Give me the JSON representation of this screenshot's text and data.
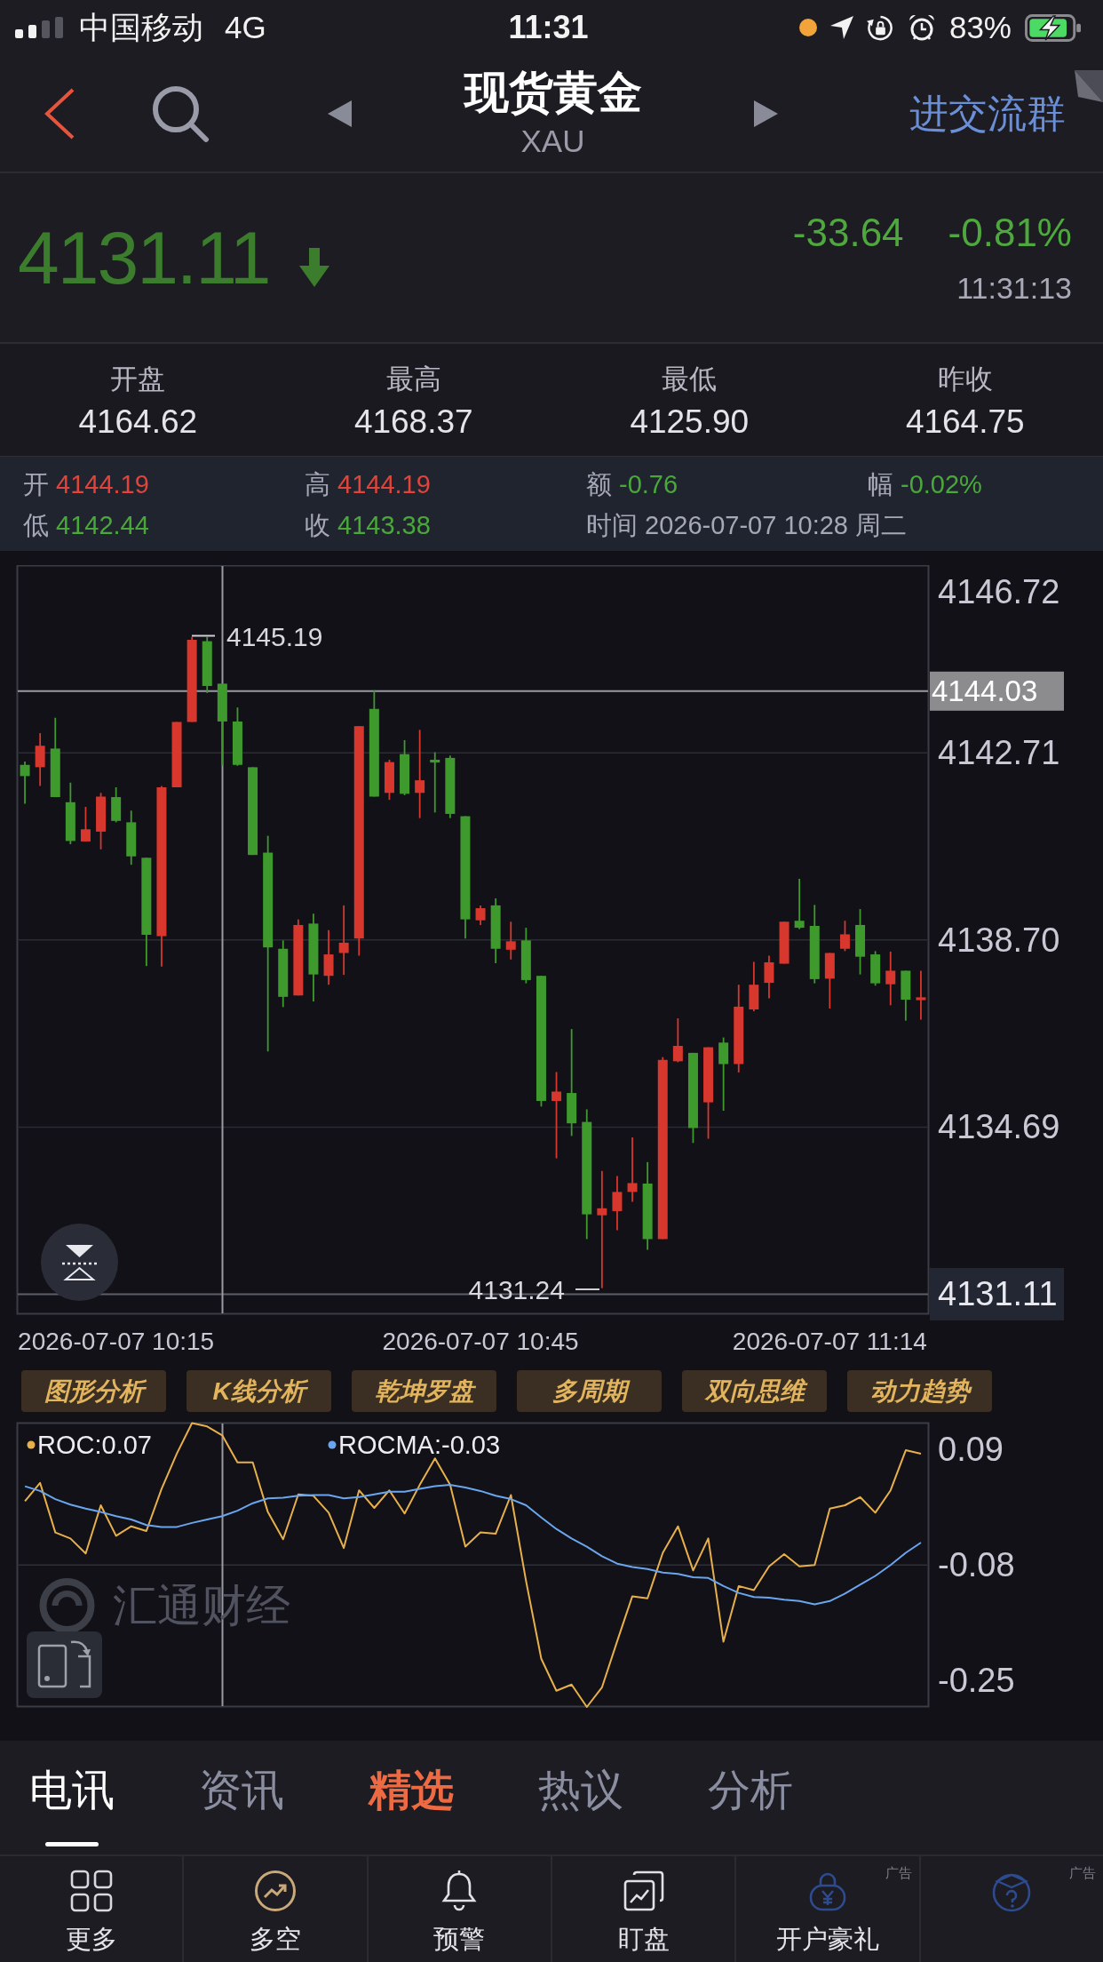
{
  "status_bar": {
    "carrier": "中国移动",
    "network": "4G",
    "time": "11:31",
    "battery": "83%"
  },
  "header": {
    "title": "现货黄金",
    "symbol": "XAU",
    "group_link": "进交流群"
  },
  "price": {
    "last": "4131.11",
    "rising": false,
    "change": "-33.64",
    "change_pct": "-0.81%",
    "time": "11:31:13"
  },
  "stats": [
    {
      "label": "开盘",
      "value": "4164.62"
    },
    {
      "label": "最高",
      "value": "4168.37"
    },
    {
      "label": "最低",
      "value": "4125.90"
    },
    {
      "label": "昨收",
      "value": "4164.75"
    }
  ],
  "quote_detail": [
    [
      {
        "label": "开",
        "value": "4144.19",
        "color": "#e0443a"
      },
      {
        "label": "高",
        "value": "4144.19",
        "color": "#e0443a"
      },
      {
        "label": "额",
        "value": "-0.76",
        "color": "#4aa83a"
      },
      {
        "label": "幅",
        "value": "-0.02%",
        "color": "#4aa83a"
      }
    ],
    [
      {
        "label": "低",
        "value": "4142.44",
        "color": "#4aa83a"
      },
      {
        "label": "收",
        "value": "4143.38",
        "color": "#4aa83a"
      },
      {
        "label": "时间",
        "value": "2026-07-07 10:28 周二",
        "color": "#a6a8b8"
      }
    ]
  ],
  "kline_chart": {
    "top_price_label": "4146.72",
    "high_label": "4145.19",
    "low_label": "4131.24",
    "chart_data": {
      "type": "candlestick",
      "categories": [
        null,
        null,
        null,
        null,
        null,
        null,
        "2026-07-07 10:15",
        null,
        null,
        null,
        null,
        null,
        null,
        null,
        null,
        null,
        null,
        null,
        null,
        null,
        null,
        null,
        null,
        null,
        null,
        null,
        null,
        null,
        null,
        null,
        "2026-07-07 10:45",
        null,
        null,
        null,
        null,
        null,
        null,
        null,
        null,
        null,
        null,
        null,
        null,
        null,
        null,
        null,
        null,
        null,
        null,
        null,
        null,
        null,
        null,
        "2026-07-07 11:14",
        null,
        null,
        null,
        null,
        null,
        null
      ],
      "ylim": [
        4130.69,
        4146.72
      ],
      "yticks": [
        {
          "value": 4142.71,
          "label": "4142.71"
        },
        {
          "value": 4138.7,
          "label": "4138.70"
        },
        {
          "value": 4134.69,
          "label": "4134.69"
        }
      ],
      "grid": true,
      "ref_lines": [
        {
          "axis": "y",
          "value": 4144.03,
          "label": "4144.03",
          "color": "#9a9aa2"
        },
        {
          "axis": "y",
          "value": 4131.11,
          "label": "4131.11",
          "color": "#5c5e68"
        }
      ],
      "ohlc": [
        [
          4142.45,
          4142.52,
          4141.62,
          4142.21
        ],
        [
          4142.4,
          4143.13,
          4142.0,
          4142.86
        ],
        [
          4142.8,
          4143.46,
          4141.76,
          4141.76
        ],
        [
          4141.65,
          4142.07,
          4140.75,
          4140.82
        ],
        [
          4140.81,
          4141.55,
          4140.81,
          4141.07
        ],
        [
          4141.02,
          4141.85,
          4140.64,
          4141.77
        ],
        [
          4141.76,
          4141.97,
          4141.22,
          4141.25
        ],
        [
          4141.22,
          4141.47,
          4140.31,
          4140.49
        ],
        [
          4140.46,
          4140.46,
          4138.14,
          4138.81
        ],
        [
          4138.78,
          4142.0,
          4138.13,
          4141.97
        ],
        [
          4141.97,
          4143.37,
          4141.97,
          4143.37
        ],
        [
          4143.37,
          4145.19,
          4143.37,
          4145.13
        ],
        [
          4145.1,
          4145.19,
          4143.99,
          4144.14
        ],
        [
          4144.19,
          4144.19,
          4142.44,
          4143.38
        ],
        [
          4143.38,
          4143.68,
          4142.43,
          4142.45
        ],
        [
          4142.4,
          4142.4,
          4140.52,
          4140.52
        ],
        [
          4140.57,
          4140.93,
          4136.31,
          4138.54
        ],
        [
          4138.51,
          4138.69,
          4137.26,
          4137.48
        ],
        [
          4137.51,
          4139.14,
          4137.51,
          4139.02
        ],
        [
          4139.05,
          4139.26,
          4137.38,
          4137.96
        ],
        [
          4137.93,
          4138.91,
          4137.74,
          4138.39
        ],
        [
          4138.42,
          4139.44,
          4137.95,
          4138.64
        ],
        [
          4138.73,
          4143.28,
          4138.36,
          4143.28
        ],
        [
          4143.65,
          4144.05,
          4141.77,
          4141.77
        ],
        [
          4141.85,
          4142.56,
          4141.7,
          4142.51
        ],
        [
          4142.68,
          4142.98,
          4141.8,
          4141.83
        ],
        [
          4141.85,
          4143.2,
          4141.31,
          4142.12
        ],
        [
          4142.56,
          4142.72,
          4141.43,
          4142.5
        ],
        [
          4142.6,
          4142.65,
          4141.31,
          4141.4
        ],
        [
          4141.35,
          4141.35,
          4138.73,
          4139.14
        ],
        [
          4139.12,
          4139.44,
          4139.02,
          4139.38
        ],
        [
          4139.44,
          4139.59,
          4138.2,
          4138.51
        ],
        [
          4138.49,
          4139.09,
          4138.28,
          4138.67
        ],
        [
          4138.69,
          4138.96,
          4137.77,
          4137.84
        ],
        [
          4137.93,
          4137.93,
          4135.13,
          4135.25
        ],
        [
          4135.25,
          4135.87,
          4134.02,
          4135.45
        ],
        [
          4135.42,
          4136.79,
          4134.5,
          4134.77
        ],
        [
          4134.8,
          4135.07,
          4132.29,
          4132.82
        ],
        [
          4132.8,
          4133.75,
          4131.24,
          4132.95
        ],
        [
          4132.89,
          4133.64,
          4132.48,
          4133.3
        ],
        [
          4133.3,
          4134.47,
          4133.09,
          4133.49
        ],
        [
          4133.48,
          4133.94,
          4132.06,
          4132.29
        ],
        [
          4132.29,
          4136.19,
          4132.29,
          4136.13
        ],
        [
          4136.1,
          4137.02,
          4136.08,
          4136.43
        ],
        [
          4136.28,
          4136.28,
          4134.35,
          4134.67
        ],
        [
          4135.22,
          4136.4,
          4134.44,
          4136.4
        ],
        [
          4136.5,
          4136.61,
          4135.04,
          4136.04
        ],
        [
          4136.04,
          4137.74,
          4135.86,
          4137.27
        ],
        [
          4137.21,
          4138.23,
          4137.17,
          4137.74
        ],
        [
          4137.78,
          4138.36,
          4137.45,
          4138.22
        ],
        [
          4138.19,
          4139.09,
          4138.19,
          4139.09
        ],
        [
          4139.11,
          4140.01,
          4138.93,
          4138.96
        ],
        [
          4139.0,
          4139.45,
          4137.77,
          4137.86
        ],
        [
          4137.87,
          4138.42,
          4137.23,
          4138.42
        ],
        [
          4138.51,
          4139.11,
          4138.46,
          4138.82
        ],
        [
          4139.02,
          4139.36,
          4137.96,
          4138.34
        ],
        [
          4138.39,
          4138.46,
          4137.72,
          4137.77
        ],
        [
          4137.75,
          4138.45,
          4137.3,
          4138.04
        ],
        [
          4138.04,
          4138.04,
          4136.97,
          4137.42
        ],
        [
          4137.41,
          4138.04,
          4136.99,
          4137.47
        ]
      ]
    }
  },
  "tools": [
    "图形分析",
    "K线分析",
    "乾坤罗盘",
    "多周期",
    "双向思维",
    "动力趋势"
  ],
  "roc_chart": {
    "legend": [
      {
        "text": "ROC:0.07"
      },
      {
        "text": "ROCMA:-0.03"
      }
    ],
    "watermark": "汇通财经",
    "chart_data": {
      "type": "line",
      "ylim": [
        -0.289,
        0.129
      ],
      "yticks": [
        0.09,
        -0.08,
        -0.25
      ],
      "ref_lines": [
        {
          "axis": "y",
          "value": -0.08,
          "color": "#2e3039"
        }
      ],
      "series": [
        {
          "color": "#e8b04a",
          "values": [
            0.014,
            0.041,
            -0.032,
            -0.041,
            -0.063,
            0.008,
            -0.037,
            -0.023,
            -0.03,
            0.032,
            0.084,
            0.129,
            0.124,
            0.111,
            0.071,
            0.071,
            -0.002,
            -0.042,
            0.024,
            0.022,
            -0.003,
            -0.055,
            0.03,
            0.004,
            0.03,
            -0.004,
            0.038,
            0.077,
            0.038,
            -0.053,
            -0.032,
            -0.034,
            0.023,
            -0.104,
            -0.218,
            -0.265,
            -0.256,
            -0.289,
            -0.26,
            -0.192,
            -0.126,
            -0.129,
            -0.062,
            -0.023,
            -0.088,
            -0.041,
            -0.193,
            -0.111,
            -0.117,
            -0.082,
            -0.064,
            -0.082,
            -0.08,
            0.003,
            0.008,
            0.02,
            -0.003,
            0.03,
            0.089,
            0.084
          ]
        },
        {
          "color": "#6aa6ee",
          "values": [
            0.036,
            0.029,
            0.017,
            0.009,
            0.003,
            -0.002,
            -0.008,
            -0.013,
            -0.021,
            -0.024,
            -0.024,
            -0.018,
            -0.013,
            -0.008,
            0,
            0.011,
            0.018,
            0.019,
            0.022,
            0.023,
            0.023,
            0.018,
            0.02,
            0.024,
            0.028,
            0.028,
            0.032,
            0.036,
            0.038,
            0.034,
            0.029,
            0.022,
            0.017,
            0.008,
            -0.01,
            -0.027,
            -0.041,
            -0.053,
            -0.067,
            -0.078,
            -0.083,
            -0.086,
            -0.091,
            -0.093,
            -0.098,
            -0.099,
            -0.111,
            -0.121,
            -0.127,
            -0.128,
            -0.131,
            -0.133,
            -0.138,
            -0.133,
            -0.122,
            -0.109,
            -0.096,
            -0.08,
            -0.062,
            -0.047
          ]
        }
      ]
    }
  },
  "news_tabs": [
    {
      "label": "电讯",
      "selected": true,
      "highlighted": false
    },
    {
      "label": "资讯",
      "selected": false,
      "highlighted": false
    },
    {
      "label": "精选",
      "selected": false,
      "highlighted": true
    },
    {
      "label": "热议",
      "selected": false,
      "highlighted": false
    },
    {
      "label": "分析",
      "selected": false,
      "highlighted": false
    }
  ],
  "bottom_nav": [
    {
      "kind": "grid",
      "label": "更多"
    },
    {
      "kind": "trend",
      "label": "多空"
    },
    {
      "kind": "bell",
      "label": "预警"
    },
    {
      "kind": "monitor",
      "label": "盯盘"
    },
    {
      "kind": "wallet",
      "label": "开户豪礼",
      "ad_tag": "广告"
    },
    {
      "kind": "course",
      "ad_tag": "广告"
    }
  ]
}
